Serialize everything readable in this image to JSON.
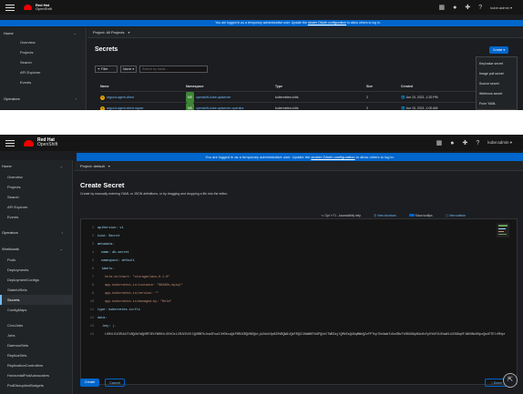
{
  "masthead": {
    "brand_line1": "Red Hat",
    "brand_line2": "OpenShift",
    "user": "kube:admin ▾"
  },
  "shot1": {
    "banner": {
      "text": "You are logged in as a temporary administrative user. Update the",
      "link": "cluster OAuth configuration",
      "suffix": "to allow others to log in."
    },
    "sidebar": {
      "home_label": "Home",
      "items": [
        "Overview",
        "Projects",
        "Search",
        "API Explorer",
        "Events"
      ],
      "operators_label": "Operators"
    },
    "project": "Project: All Projects",
    "title": "Secrets",
    "create_label": "Create ▾",
    "create_menu": [
      "Key/value secret",
      "Image pull secret",
      "Source secret",
      "Webhook secret",
      "From YAML"
    ],
    "filter_label": "Filter",
    "name_label": "Name",
    "search_placeholder": "Search by name...",
    "columns": [
      "Name",
      "Namespace",
      "Type",
      "Size",
      "Created"
    ],
    "rows": [
      {
        "name": "argocd-agent-client",
        "namespace": "openshift-kube-apiserver",
        "type": "kubernetes.io/tls",
        "size": "2",
        "created": "Jun 10, 2021, 1:20 PM"
      },
      {
        "name": "argocd-agent-client-signer",
        "namespace": "openshift-kube-apiserver-operator",
        "type": "kubernetes.io/tls",
        "size": "2",
        "created": "Jun 10, 2021, 1:00 AM"
      }
    ]
  },
  "shot2": {
    "banner": {
      "text": "You are logged in as a temporary administrative user. Update the",
      "link": "cluster OAuth configuration",
      "suffix": "to allow others to log in."
    },
    "sidebar": {
      "home_label": "Home",
      "home_items": [
        "Overview",
        "Projects",
        "Search",
        "API Explorer",
        "Events"
      ],
      "operators_label": "Operators",
      "workloads_label": "Workloads",
      "workload_items": [
        "Pods",
        "Deployments",
        "DeploymentConfigs",
        "StatefulSets",
        "Secrets",
        "ConfigMaps",
        "",
        "CronJobs",
        "Jobs",
        "DaemonSets",
        "ReplicaSets",
        "ReplicationControllers",
        "HorizontalPodAutoscalers",
        "PodDisruptionBudgets"
      ]
    },
    "project": "Project: default",
    "title": "Create Secret",
    "description": "Create by manually entering YAML or JSON definitions, or by dragging and dropping a file into the editor.",
    "toolbar": {
      "shortcut": "⌥ Opt + F1 - Accessibility help",
      "view_shortcuts": "View shortcuts",
      "show_tooltips": "Show tooltips",
      "view_sidebar": "View sidebar"
    },
    "code_lines": [
      "apiVersion: v1",
      "kind: Secret",
      "metadata:",
      "  name: db-secret",
      "  namespace: default",
      "  labels:",
      "    helm.sh/chart: \"storageclass-0.1.0\"",
      "    app.kubernetes.io/instance: \"0b5d5b-mysql\"",
      "    app.kubernetes.io/version: \"\"",
      "    app.kubernetes.io/managed-by: \"Helm\"",
      "type: kubernetes.io/tls",
      "data:",
      "  .key: |-",
      "    LS0tLS1CRUdJTiBQUklWQVRFIEtFWS0tLS0tCk1JSUV2UUlCQURBTkJna3Foa2lHOXcwQkFRRUZBQVNDQktjd2dnU2pBZ0VBQW9JQkFRQ3lDbWN0Tk9PQkhCTWRZajlQMVZaQU9qMWhQZzFPTkpTUnNwbTd1eDBvTkRGUG9pN3o0cFpEVkRlU2hwNldJOG9qUFJWVUNoS0pzQmJETElrRHpr"
    ],
    "create_label": "Create",
    "cancel_label": "Cancel",
    "download_label": "Down"
  }
}
